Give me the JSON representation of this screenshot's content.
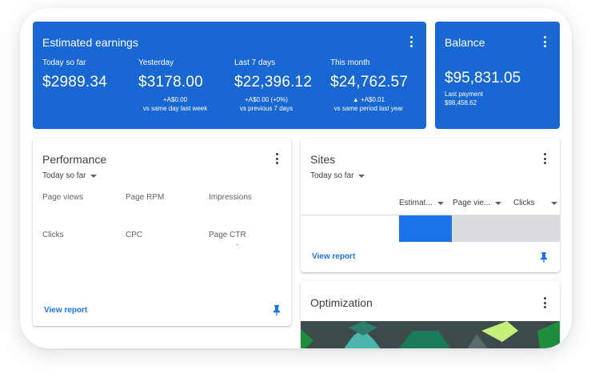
{
  "earnings": {
    "title": "Estimated earnings",
    "metrics": [
      {
        "label": "Today so far",
        "value": "$2989.34",
        "sub1": "",
        "sub2": ""
      },
      {
        "label": "Yesterday",
        "value": "$3178.00",
        "sub1": "+A$0.00",
        "sub2": "vs same day last week"
      },
      {
        "label": "Last 7 days",
        "value": "$22,396.12",
        "sub1": "+A$0.00 (+0%)",
        "sub2": "vs previous 7 days"
      },
      {
        "label": "This month",
        "value": "$24,762.57",
        "sub1": "▲ +A$0.01",
        "sub2": "vs same period last year"
      }
    ]
  },
  "balance": {
    "title": "Balance",
    "value": "$95,831.05",
    "last_payment_label": "Last payment",
    "last_payment_value": "$98,458.62"
  },
  "performance": {
    "title": "Performance",
    "period": "Today so far",
    "stats": [
      "Page views",
      "Page RPM",
      "Impressions",
      "Clicks",
      "CPC",
      "Page CTR"
    ],
    "ctr_value": "-",
    "link": "View report"
  },
  "sites": {
    "title": "Sites",
    "period": "Today so far",
    "columns": [
      "Estimat...",
      "Page vie...",
      "Clicks"
    ],
    "link": "View report",
    "bar_fraction": 0.33
  },
  "optimization": {
    "title": "Optimization"
  },
  "colors": {
    "accent": "#1967d2",
    "link": "#1a73e8",
    "bar": "#1a73e8",
    "bar_track": "#dadce0"
  },
  "icons": [
    "more-vert-icon",
    "dropdown-arrow-icon",
    "pin-icon"
  ]
}
